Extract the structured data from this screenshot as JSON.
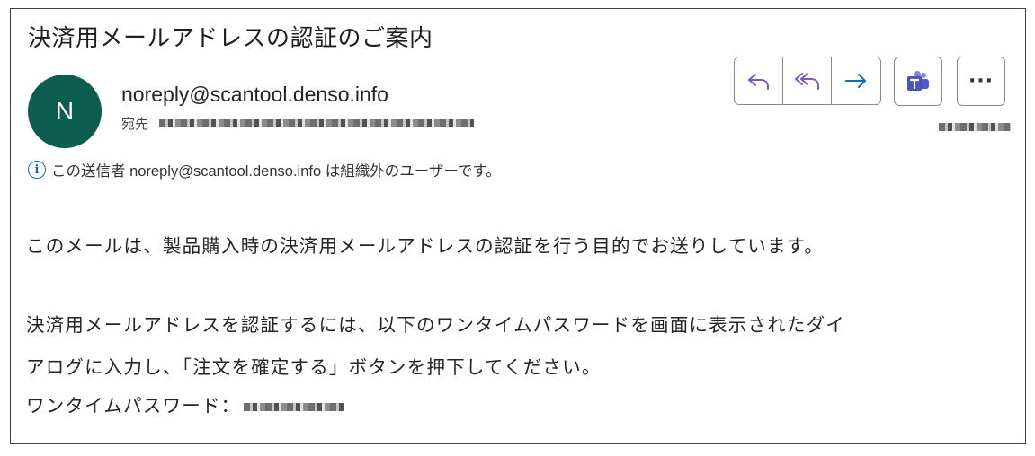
{
  "subject": "決済用メールアドレスの認証のご案内",
  "sender": {
    "avatar_initial": "N",
    "email": "noreply@scantool.denso.info",
    "to_label": "宛先"
  },
  "notice": {
    "text": "この送信者 noreply@scantool.denso.info は組織外のユーザーです。"
  },
  "toolbar": {
    "reply_icon": "reply-icon",
    "reply_all_icon": "reply-all-icon",
    "forward_icon": "forward-icon",
    "teams_icon": "teams-icon",
    "more_label": "···"
  },
  "body": {
    "line1": "このメールは、製品購入時の決済用メールアドレスの認証を行う目的でお送りしています。",
    "line2": "決済用メールアドレスを認証するには、以下のワンタイムパスワードを画面に表示されたダイ",
    "line3": "アログに入力し、「注文を確定する」ボタンを押下してください。",
    "otp_label": "ワンタイムパスワード："
  },
  "colors": {
    "avatar": "#0b5e4f",
    "accent": "#7b59b8",
    "forward": "#0f6cbd",
    "info": "#0f6cbd"
  }
}
